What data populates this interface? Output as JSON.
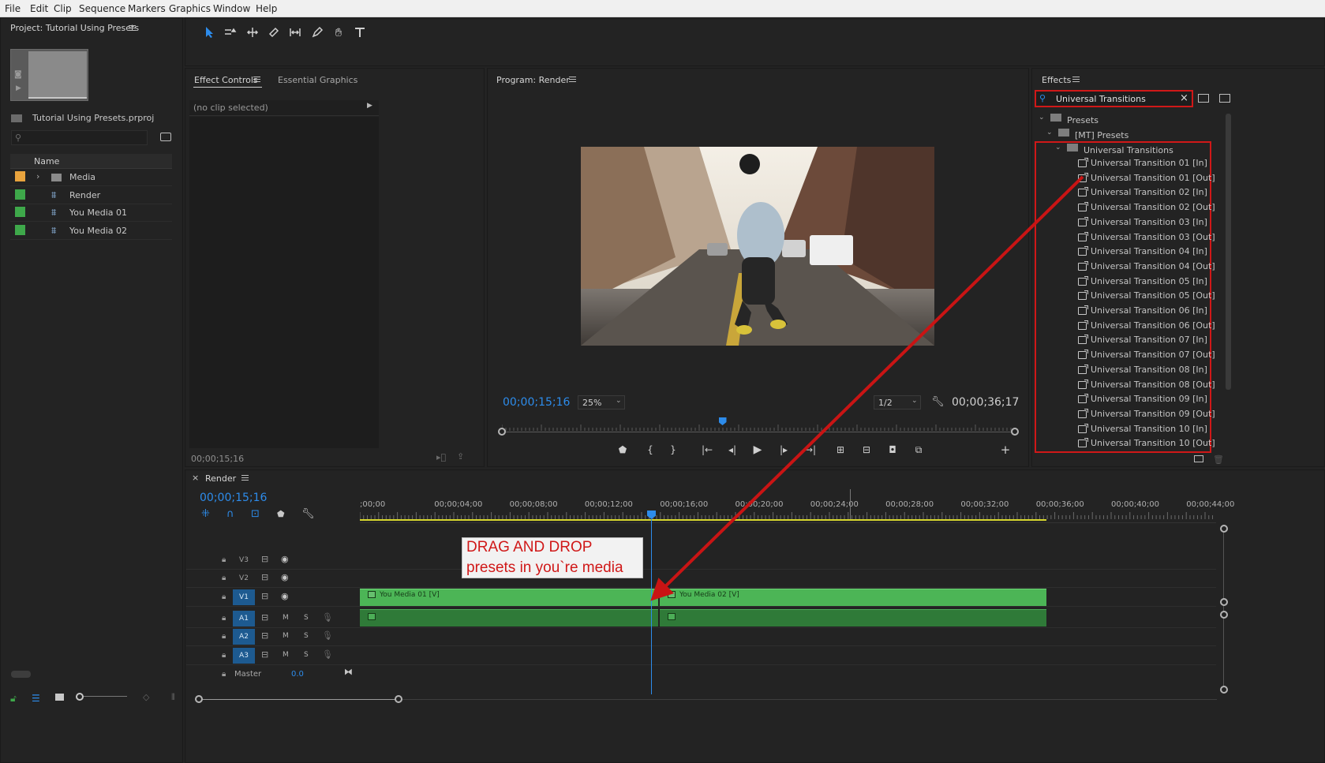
{
  "menu": [
    "File",
    "Edit",
    "Clip",
    "Sequence",
    "Markers",
    "Graphics",
    "Window",
    "Help"
  ],
  "project": {
    "title": "Project: Tutorial Using Presets",
    "file_name": "Tutorial Using Presets.prproj",
    "col_name": "Name",
    "items": [
      {
        "label": "Media",
        "color": "#e8a33d",
        "icon": "folder-icon",
        "expander": "›"
      },
      {
        "label": "Render",
        "color": "#3ea84a",
        "icon": "sequence-icon"
      },
      {
        "label": "You Media 01",
        "color": "#3ea84a",
        "icon": "sequence-icon"
      },
      {
        "label": "You Media 02",
        "color": "#3ea84a",
        "icon": "sequence-icon"
      }
    ]
  },
  "tools": [
    "selection-tool",
    "track-select-tool",
    "ripple-edit-tool",
    "razor-tool",
    "slip-tool",
    "pen-tool",
    "hand-tool",
    "type-tool"
  ],
  "effect_controls": {
    "tab1": "Effect Controls",
    "tab2": "Essential Graphics",
    "no_clip": "(no clip selected)",
    "timecode": "00;00;15;16"
  },
  "program": {
    "title": "Program: Render",
    "timecode": "00;00;15;16",
    "zoom": "25%",
    "resolution": "1/2",
    "duration": "00;00;36;17",
    "playhead_fraction": 0.43
  },
  "effects": {
    "title": "Effects",
    "search_value": "Universal Transitions",
    "tree_presets": "Presets",
    "tree_mt": "[MT] Presets",
    "tree_ut": "Universal Transitions",
    "items": [
      "Universal Transition 01 [In]",
      "Universal Transition 01 [Out]",
      "Universal Transition 02 [In]",
      "Universal Transition 02 [Out]",
      "Universal Transition 03 [In]",
      "Universal Transition 03 [Out]",
      "Universal Transition 04 [In]",
      "Universal Transition 04 [Out]",
      "Universal Transition 05 [In]",
      "Universal Transition 05 [Out]",
      "Universal Transition 06 [In]",
      "Universal Transition 06 [Out]",
      "Universal Transition 07 [In]",
      "Universal Transition 07 [Out]",
      "Universal Transition 08 [In]",
      "Universal Transition 08 [Out]",
      "Universal Transition 09 [In]",
      "Universal Transition 09 [Out]",
      "Universal Transition 10 [In]",
      "Universal Transition 10 [Out]"
    ]
  },
  "timeline": {
    "sequence": "Render",
    "close": "×",
    "timecode": "00;00;15;16",
    "ruler": [
      ";00;00",
      "00;00;04;00",
      "00;00;08;00",
      "00;00;12;00",
      "00;00;16;00",
      "00;00;20;00",
      "00;00;24;00",
      "00;00;28;00",
      "00;00;32;00",
      "00;00;36;00",
      "00;00;40;00",
      "00;00;44;00"
    ],
    "video_tracks": [
      "V3",
      "V2",
      "V1"
    ],
    "audio_tracks": [
      "A1",
      "A2",
      "A3"
    ],
    "master_label": "Master",
    "master_value": "0.0",
    "clip1": "You Media 01 [V]",
    "clip2": "You Media 02 [V]",
    "mute": "M",
    "solo": "S",
    "fx": "fx"
  },
  "annotation": {
    "line1": "DRAG AND DROP",
    "line2": "presets in you`re media",
    "color": "#d01818"
  }
}
